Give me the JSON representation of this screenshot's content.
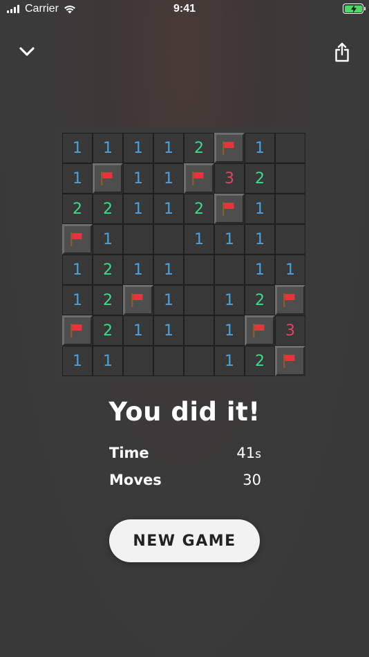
{
  "status_bar": {
    "carrier": "Carrier",
    "time": "9:41",
    "battery_color": "#4cd964"
  },
  "nav": {
    "close_icon": "chevron-down-icon",
    "share_icon": "share-icon"
  },
  "board": {
    "rows": 8,
    "cols": 8,
    "cells": [
      [
        "1",
        "1",
        "1",
        "1",
        "2",
        "F",
        "1",
        ""
      ],
      [
        "1",
        "F",
        "1",
        "1",
        "F",
        "3",
        "2",
        ""
      ],
      [
        "2",
        "2",
        "1",
        "1",
        "2",
        "F",
        "1",
        ""
      ],
      [
        "F",
        "1",
        "",
        "",
        "1",
        "1",
        "1",
        ""
      ],
      [
        "1",
        "2",
        "1",
        "1",
        "",
        "",
        "1",
        "1"
      ],
      [
        "1",
        "2",
        "F",
        "1",
        "",
        "1",
        "2",
        "F"
      ],
      [
        "F",
        "2",
        "1",
        "1",
        "",
        "1",
        "F",
        "3"
      ],
      [
        "1",
        "1",
        "",
        "",
        "",
        "1",
        "2",
        "F"
      ]
    ],
    "number_colors": {
      "1": "#4aa3e0",
      "2": "#3ddc84",
      "3": "#e0455a"
    },
    "flag_color": "#e8323c"
  },
  "result": {
    "title": "You did it!",
    "time_label": "Time",
    "time_value": "41",
    "time_unit": "s",
    "moves_label": "Moves",
    "moves_value": "30"
  },
  "actions": {
    "new_game_label": "NEW GAME"
  }
}
